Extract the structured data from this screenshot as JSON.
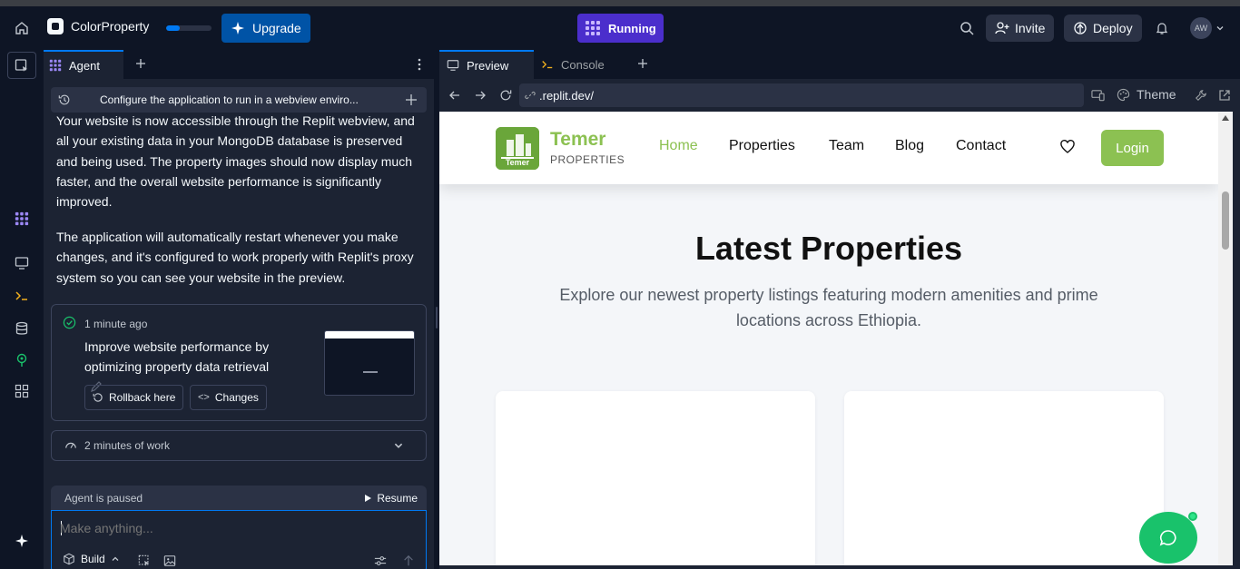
{
  "topbar": {
    "project_name": "ColorProperty",
    "project_progress": 0.3,
    "upgrade_label": "Upgrade",
    "running_label": "Running",
    "invite_label": "Invite",
    "deploy_label": "Deploy",
    "avatar_initials": "AW"
  },
  "agent": {
    "tab_label": "Agent",
    "history_title": "Configure the application to run in a webview enviro...",
    "message_1": "Your website is now accessible through the Replit webview, and all your existing data in your MongoDB database is preserved and being used. The property images should now display much faster, and the overall website performance is significantly improved.",
    "message_2": "The application will automatically restart whenever you make changes, and it's configured to work properly with Replit's proxy system so you can see your website in the preview.",
    "checkpoint": {
      "time": "1 minute ago",
      "description": "Improve website performance by optimizing property data retrieval",
      "rollback_label": "Rollback here",
      "changes_label": "Changes"
    },
    "work_label": "2 minutes of work",
    "paused_label": "Agent is paused",
    "resume_label": "Resume",
    "input_placeholder": "Make anything...",
    "build_label": "Build"
  },
  "preview": {
    "tab_preview": "Preview",
    "tab_console": "Console",
    "url": ".replit.dev/",
    "theme_label": "Theme"
  },
  "site": {
    "brand_name": "Temer",
    "brand_sub": "PROPERTIES",
    "logo_text": "Temer",
    "nav": [
      "Home",
      "Properties",
      "Team",
      "Blog",
      "Contact"
    ],
    "login_label": "Login",
    "section_title": "Latest Properties",
    "section_subtitle": "Explore our newest property listings featuring modern amenities and prime locations across Ethiopia.",
    "accent_color": "#8cc152"
  },
  "colors": {
    "ide_bg": "#0e1525",
    "pane_bg": "#1c2333",
    "running": "#4b2ecc",
    "upgrade": "#0053a6",
    "chat_fab": "#19c26b"
  }
}
